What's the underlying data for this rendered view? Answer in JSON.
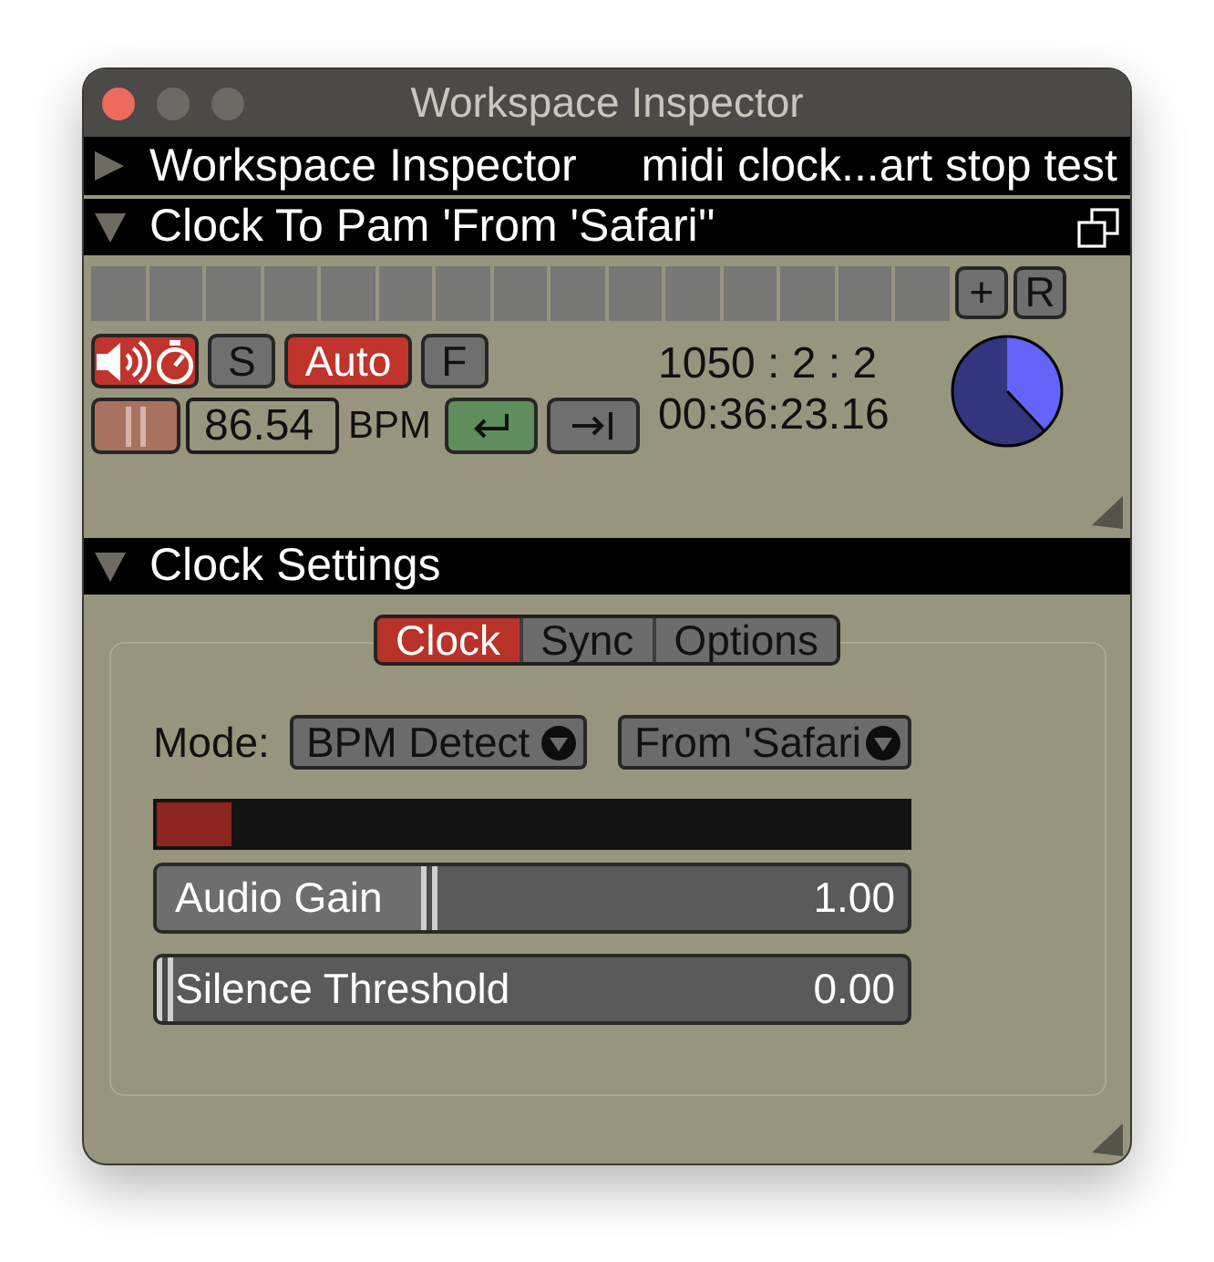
{
  "window": {
    "title": "Workspace Inspector"
  },
  "workspace_header": {
    "expanded": false,
    "title": "Workspace Inspector",
    "workspace": "midi clock...art stop test"
  },
  "cue_header": {
    "expanded": true,
    "title": "Clock To Pam 'From 'Safari''"
  },
  "pads": [
    {
      "lit": false
    },
    {
      "lit": false
    },
    {
      "lit": false
    },
    {
      "lit": false
    },
    {
      "lit": false
    },
    {
      "lit": false
    },
    {
      "lit": false
    },
    {
      "lit": false
    },
    {
      "lit": false
    },
    {
      "lit": false
    },
    {
      "lit": false
    },
    {
      "lit": false
    },
    {
      "lit": false
    },
    {
      "lit": false
    },
    {
      "lit": false
    }
  ],
  "pad_buttons": [
    "+",
    "R"
  ],
  "transport": {
    "toggles": [
      {
        "kind": "sound_timer",
        "on": true
      },
      {
        "kind": "label",
        "label": "S",
        "on": false
      },
      {
        "kind": "label",
        "label": "Auto",
        "on": true
      },
      {
        "kind": "label",
        "label": "F",
        "on": false
      }
    ],
    "pause": {
      "disabled": true
    },
    "bpm": {
      "value": "86.54",
      "unit": "BPM"
    },
    "actions": [
      {
        "kind": "return",
        "on": true
      },
      {
        "kind": "jump_to_end",
        "on": false
      }
    ],
    "position": "1050 : 2 : 2",
    "time": "00:36:23.16",
    "beat_dial": {
      "level": 0.38
    }
  },
  "settings": {
    "expanded": true,
    "title": "Clock Settings",
    "tabs": [
      {
        "label": "Clock",
        "selected": true
      },
      {
        "label": "Sync",
        "selected": false
      },
      {
        "label": "Options",
        "selected": false
      }
    ],
    "mode": {
      "label": "Mode:",
      "value": "BPM Detect"
    },
    "source": {
      "value": "From 'Safari"
    },
    "input_meter": {
      "level": 0.1
    },
    "sliders": [
      {
        "label": "Audio Gain",
        "value": "1.00",
        "level": 0.36
      },
      {
        "label": "Silence Threshold",
        "value": "0.00",
        "level": 0
      }
    ]
  }
}
